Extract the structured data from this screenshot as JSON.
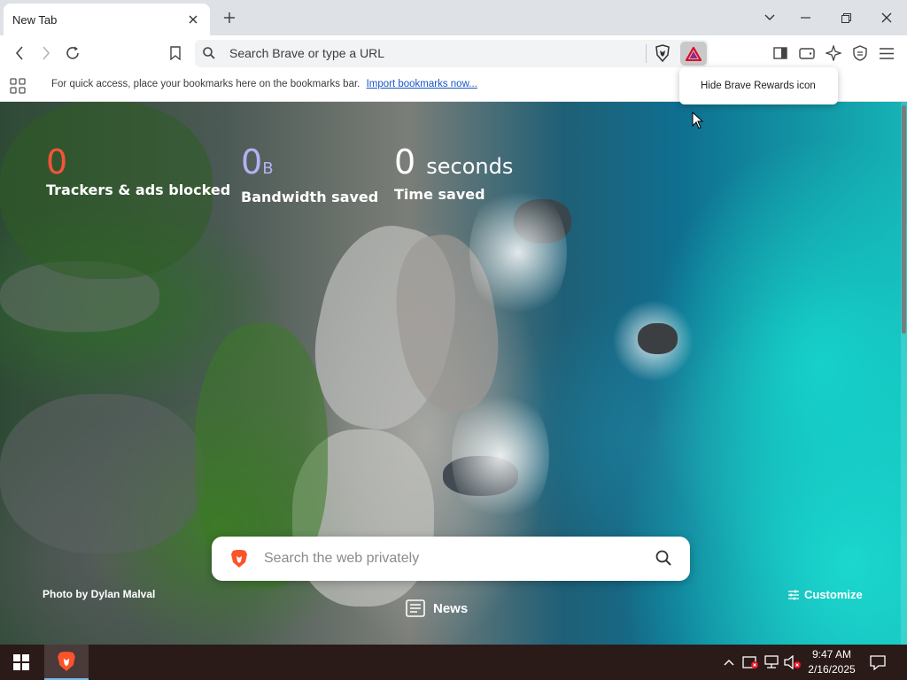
{
  "tab": {
    "title": "New Tab"
  },
  "omnibox": {
    "placeholder": "Search Brave or type a URL"
  },
  "bookmarks_bar": {
    "hint": "For quick access, place your bookmarks here on the bookmarks bar.",
    "import_link": "Import bookmarks now..."
  },
  "context_menu": {
    "item": "Hide Brave Rewards icon"
  },
  "stats": {
    "trackers": {
      "value": "0",
      "label": "Trackers & ads blocked",
      "color": "#f4543a"
    },
    "bandwidth": {
      "value": "0",
      "unit": "B",
      "label": "Bandwidth saved",
      "color": "#b6b0f5"
    },
    "time": {
      "value": "0",
      "unit": "seconds",
      "label": "Time saved",
      "color": "#ffffff"
    }
  },
  "search": {
    "placeholder": "Search the web privately"
  },
  "photo_credit": "Photo by Dylan Malval",
  "news_label": "News",
  "customize_label": "Customize",
  "taskbar": {
    "time": "9:47 AM",
    "date": "2/16/2025"
  },
  "colors": {
    "brave_orange": "#fb542b",
    "rewards_red": "#e2052a",
    "link_blue": "#1a55c7"
  }
}
